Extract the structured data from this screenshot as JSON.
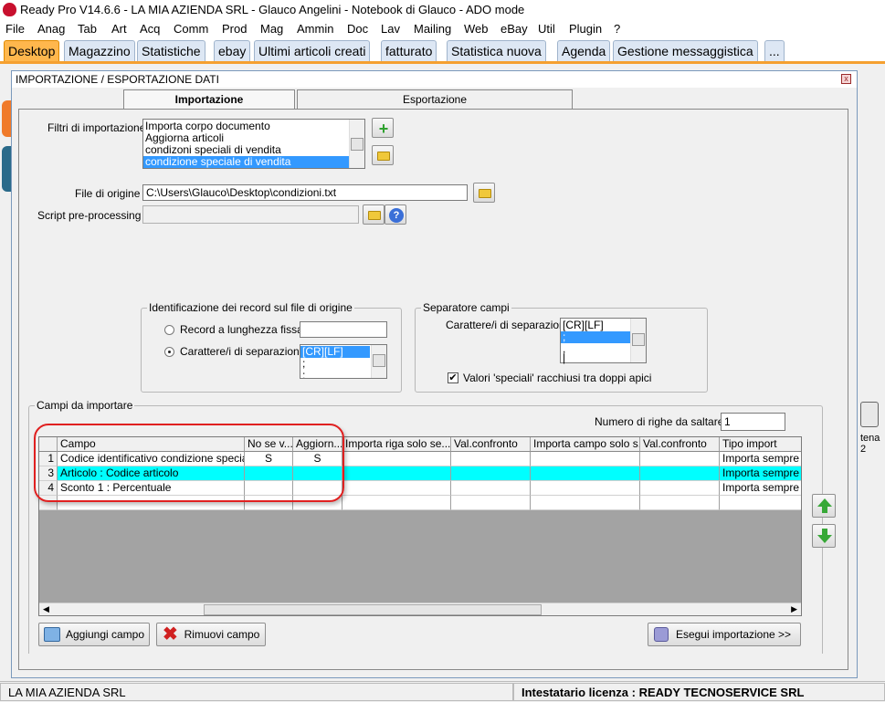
{
  "window": {
    "title": "Ready Pro V14.6.6 - LA MIA AZIENDA SRL - Glauco Angelini - Notebook di Glauco - ADO mode"
  },
  "menu": [
    "File",
    "Anag",
    "Tab",
    "Art",
    "Acq",
    "Comm",
    "Prod",
    "Mag",
    "Ammin",
    "Doc",
    "Lav",
    "Mailing",
    "Web",
    "eBay",
    "Util",
    "Plugin",
    "?"
  ],
  "tabs": [
    "Desktop",
    "Magazzino",
    "Statistiche",
    "ebay",
    "Ultimi articoli creati",
    "fatturato",
    "Statistica nuova",
    "Agenda",
    "Gestione messaggistica",
    "..."
  ],
  "dialog": {
    "title": "IMPORTAZIONE / ESPORTAZIONE DATI",
    "close_label": "x",
    "tab_import": "Importazione",
    "tab_export": "Esportazione",
    "filters_label": "Filtri di importazione :",
    "filters": [
      "Importa corpo documento",
      "Aggiorna articoli",
      "condizoni speciali di vendita",
      "condizione speciale di vendita"
    ],
    "file_label": "File di origine :",
    "file_value": "C:\\Users\\Glauco\\Desktop\\condizioni.txt",
    "script_label": "Script pre-processing :",
    "script_value": "",
    "ident_group": "Identificazione dei record sul file di origine",
    "radio_fixed": "Record a lunghezza fissa",
    "radio_sep": "Carattere/i di separazione",
    "radio_sep_items": [
      "[CR][LF]",
      ";",
      ";"
    ],
    "sep_group": "Separatore campi",
    "sep_label": "Carattere/i di separazione",
    "sep_items": [
      "[CR][LF]",
      ";",
      ",",
      "|"
    ],
    "quotes_label": "Valori 'speciali' racchiusi tra doppi apici",
    "fields_group": "Campi da importare",
    "skip_label": "Numero di righe da saltare :",
    "skip_value": "1",
    "grid_headers": [
      "Campo",
      "No se v...",
      "Aggiorn...",
      "Importa riga solo se...",
      "Val.confronto",
      "Importa campo solo s...",
      "Val.confronto",
      "Tipo import"
    ],
    "grid_rows": [
      {
        "n": "1",
        "campo": "Codice identificativo condizione speciale",
        "nosev": "S",
        "agg": "S",
        "imp_riga": "",
        "val1": "",
        "imp_campo": "",
        "val2": "",
        "tipo": "Importa sempre"
      },
      {
        "n": "3",
        "campo": "Articolo : Codice articolo",
        "nosev": "",
        "agg": "",
        "imp_riga": "",
        "val1": "",
        "imp_campo": "",
        "val2": "",
        "tipo": "Importa sempre"
      },
      {
        "n": "4",
        "campo": "Sconto 1 : Percentuale",
        "nosev": "",
        "agg": "",
        "imp_riga": "",
        "val1": "",
        "imp_campo": "",
        "val2": "",
        "tipo": "Importa sempre"
      }
    ],
    "add_field": "Aggiungi campo",
    "remove_field": "Rimuovi campo",
    "run_import": "Esegui importazione >>"
  },
  "side_label": "tena 2",
  "status": {
    "left": "LA MIA AZIENDA SRL",
    "right": "Intestatario licenza : READY TECNOSERVICE SRL"
  },
  "colors": {
    "tab_active": "#ffb74d",
    "row_selected": "#00ffff",
    "highlight_ring": "#e02020"
  }
}
